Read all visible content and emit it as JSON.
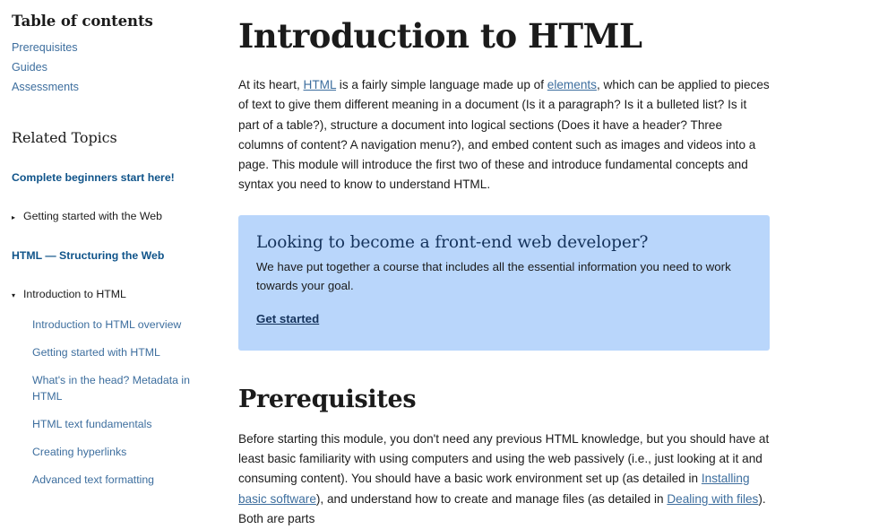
{
  "sidebar": {
    "toc_title": "Table of contents",
    "toc_items": [
      {
        "label": "Prerequisites"
      },
      {
        "label": "Guides"
      },
      {
        "label": "Assessments"
      }
    ],
    "related_title": "Related Topics",
    "sections": [
      {
        "heading": "Complete beginners start here!",
        "toggle_icon": "chevron-right-icon",
        "toggle_glyph": "▸",
        "toggle_label": "Getting started with the Web",
        "expanded": false,
        "children": []
      },
      {
        "heading": "HTML — Structuring the Web",
        "toggle_icon": "chevron-down-icon",
        "toggle_glyph": "▾",
        "toggle_label": "Introduction to HTML",
        "expanded": true,
        "children": [
          {
            "label": "Introduction to HTML overview"
          },
          {
            "label": "Getting started with HTML"
          },
          {
            "label": "What's in the head? Metadata in HTML"
          },
          {
            "label": "HTML text fundamentals"
          },
          {
            "label": "Creating hyperlinks"
          },
          {
            "label": "Advanced text formatting"
          }
        ]
      }
    ]
  },
  "main": {
    "title": "Introduction to HTML",
    "intro": {
      "part1": "At its heart, ",
      "link1": "HTML",
      "part2": " is a fairly simple language made up of ",
      "link2": "elements",
      "part3": ", which can be applied to pieces of text to give them different meaning in a document (Is it a paragraph? Is it a bulleted list? Is it part of a table?), structure a document into logical sections (Does it have a header? Three columns of content? A navigation menu?), and embed content such as images and videos into a page. This module will introduce the first two of these and introduce fundamental concepts and syntax you need to know to understand HTML."
    },
    "callout": {
      "title": "Looking to become a front-end web developer?",
      "body": "We have put together a course that includes all the essential information you need to work towards your goal.",
      "cta_label": "Get started"
    },
    "prerequisites": {
      "heading": "Prerequisites",
      "part1": "Before starting this module, you don't need any previous HTML knowledge, but you should have at least basic familiarity with using computers and using the web passively (i.e., just looking at it and consuming content). You should have a basic work environment set up (as detailed in ",
      "link1": "Installing basic software",
      "part2": "), and understand how to create and manage files (as detailed in ",
      "link2": "Dealing with files",
      "part3": "). Both are parts"
    }
  },
  "colors": {
    "link": "#3d6e9e",
    "nav_heading": "#10548a",
    "callout_bg": "#b9d6fb",
    "callout_text": "#15335c",
    "text": "#1b1b1b",
    "background": "#ffffff"
  }
}
